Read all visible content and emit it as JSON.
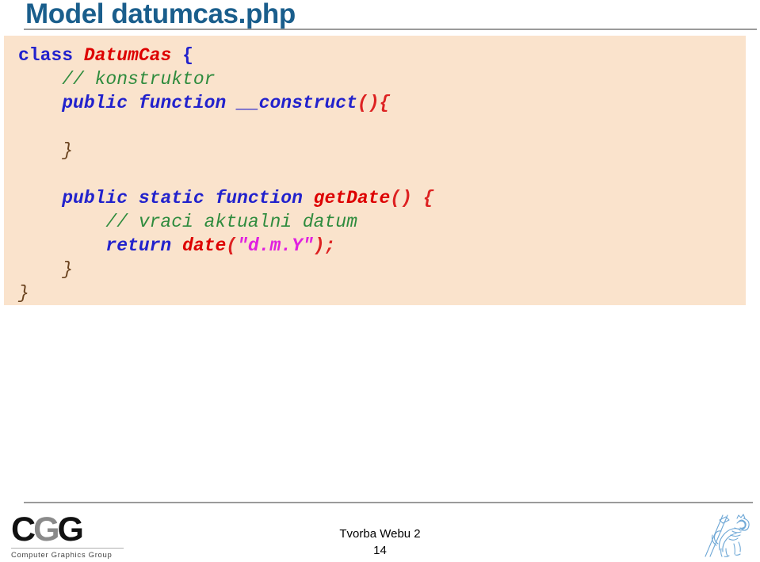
{
  "slide": {
    "title": "Model datumcas.php",
    "title_color": "#1A5E8C",
    "panel_bg": "#FAE3CC"
  },
  "code": {
    "language": "php",
    "lines": [
      [
        {
          "t": "class ",
          "c": "kw"
        },
        {
          "t": "DatumCas ",
          "c": "cls"
        },
        {
          "t": "{",
          "c": "brace-blue"
        }
      ],
      [
        {
          "t": "    // konstruktor",
          "c": "cmt"
        }
      ],
      [
        {
          "t": "    ",
          "c": "plain"
        },
        {
          "t": "public function ",
          "c": "kw-i"
        },
        {
          "t": "__construct",
          "c": "kw-i"
        },
        {
          "t": "(){",
          "c": "punc"
        }
      ],
      [
        {
          "t": "",
          "c": "plain"
        }
      ],
      [
        {
          "t": "    }",
          "c": "brc"
        }
      ],
      [
        {
          "t": "",
          "c": "plain"
        }
      ],
      [
        {
          "t": "    ",
          "c": "plain"
        },
        {
          "t": "public static function ",
          "c": "kw-i"
        },
        {
          "t": "getDate",
          "c": "fn"
        },
        {
          "t": "() {",
          "c": "punc"
        }
      ],
      [
        {
          "t": "        // vraci aktualni datum",
          "c": "cmt"
        }
      ],
      [
        {
          "t": "        ",
          "c": "plain"
        },
        {
          "t": "return ",
          "c": "kw-i"
        },
        {
          "t": "date",
          "c": "fn"
        },
        {
          "t": "(",
          "c": "punc"
        },
        {
          "t": "\"d.m.Y\"",
          "c": "str"
        },
        {
          "t": ");",
          "c": "punc"
        }
      ],
      [
        {
          "t": "    }",
          "c": "brc"
        }
      ],
      [
        {
          "t": "}",
          "c": "brc"
        }
      ]
    ]
  },
  "footer": {
    "course": "Tvorba Webu 2",
    "page_number": "14",
    "logo": {
      "letters": [
        "C",
        "G",
        "G"
      ],
      "subtitle": "Computer Graphics Group"
    },
    "emblem_name": "ctu-lion-emblem"
  }
}
